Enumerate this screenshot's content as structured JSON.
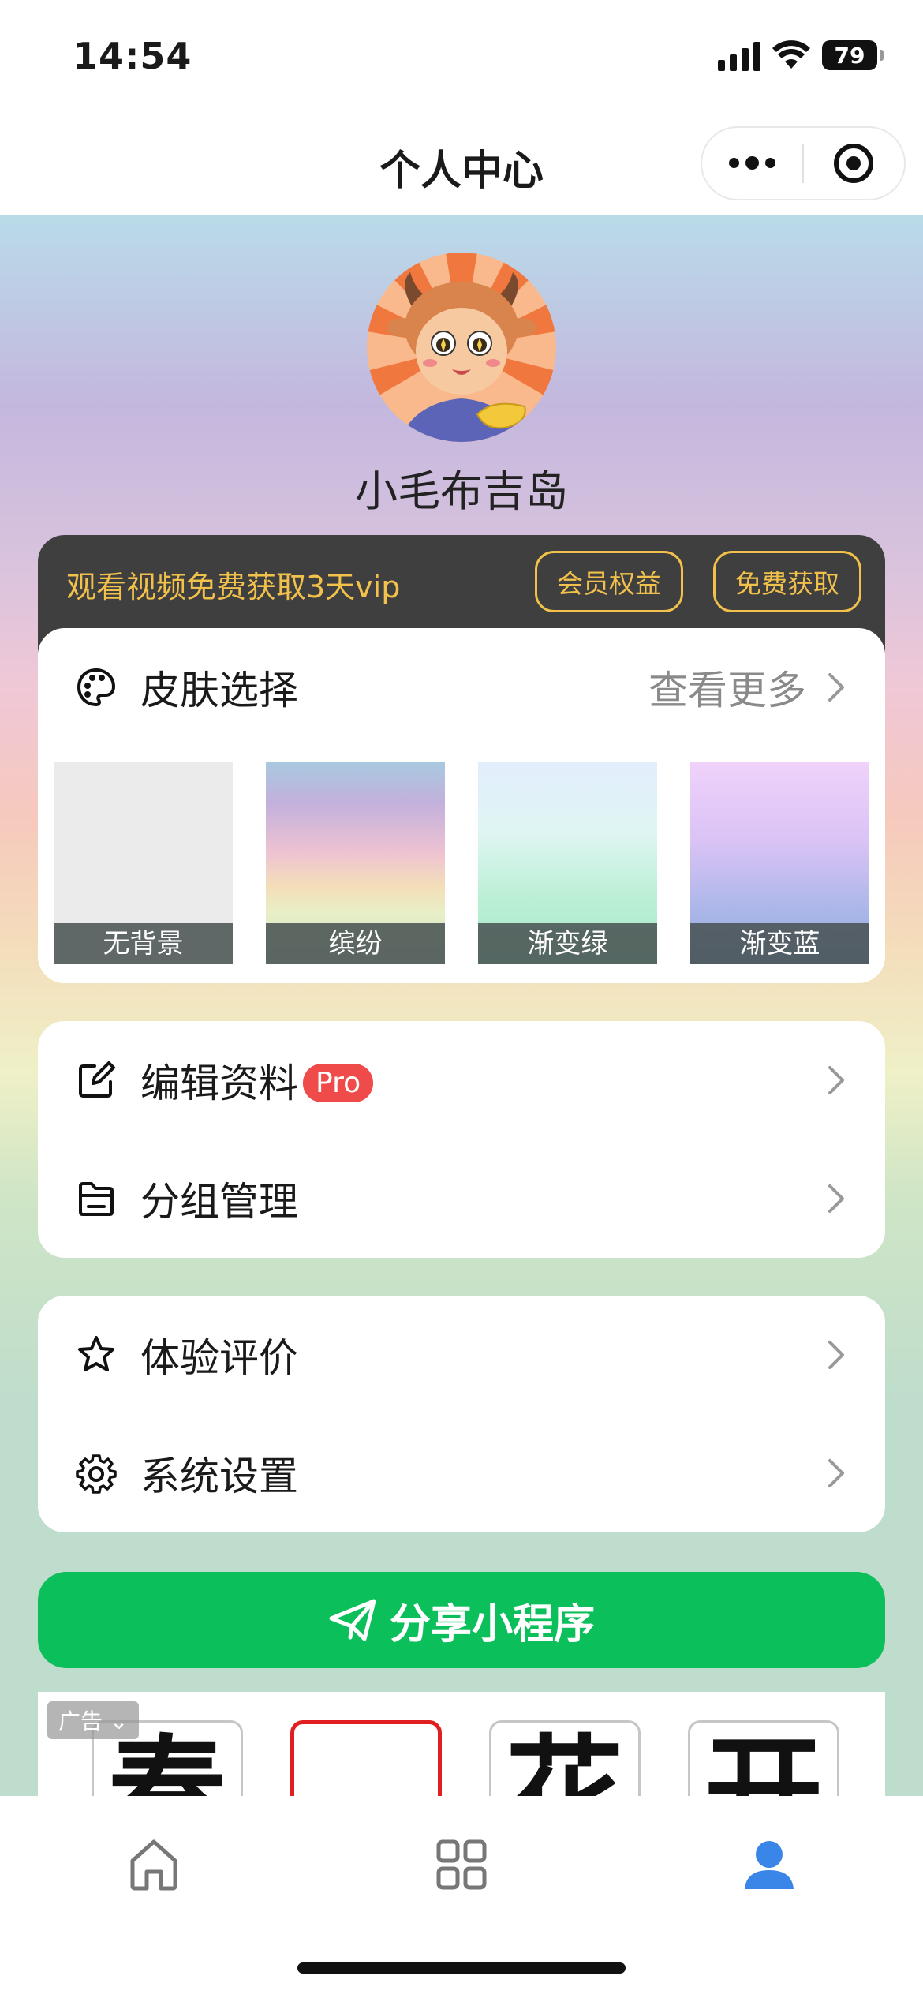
{
  "status_bar": {
    "time": "14:54",
    "battery": "79"
  },
  "nav": {
    "title": "个人中心"
  },
  "profile": {
    "username": "小毛布吉岛"
  },
  "vip": {
    "text": "观看视频免费获取3天vip",
    "benefits_label": "会员权益",
    "free_label": "免费获取",
    "accent_color": "#f2c14b"
  },
  "skin_section": {
    "title": "皮肤选择",
    "more_label": "查看更多",
    "skins": [
      {
        "label": "无背景"
      },
      {
        "label": "缤纷"
      },
      {
        "label": "渐变绿"
      },
      {
        "label": "渐变蓝"
      }
    ]
  },
  "menu_group_1": [
    {
      "label": "编辑资料",
      "badge": "Pro",
      "icon": "edit-icon"
    },
    {
      "label": "分组管理",
      "icon": "folder-icon"
    }
  ],
  "menu_group_2": [
    {
      "label": "体验评价",
      "icon": "star-icon"
    },
    {
      "label": "系统设置",
      "icon": "gear-icon"
    }
  ],
  "share": {
    "label": "分享小程序",
    "color": "#0bbf5b"
  },
  "ad": {
    "tag": "广告",
    "tiles": [
      "春",
      "",
      "花",
      "开"
    ]
  },
  "tabbar": {
    "tabs": [
      {
        "icon": "home-icon",
        "active": false
      },
      {
        "icon": "grid-icon",
        "active": false
      },
      {
        "icon": "user-icon",
        "active": true
      }
    ],
    "active_color": "#3a86e8"
  }
}
